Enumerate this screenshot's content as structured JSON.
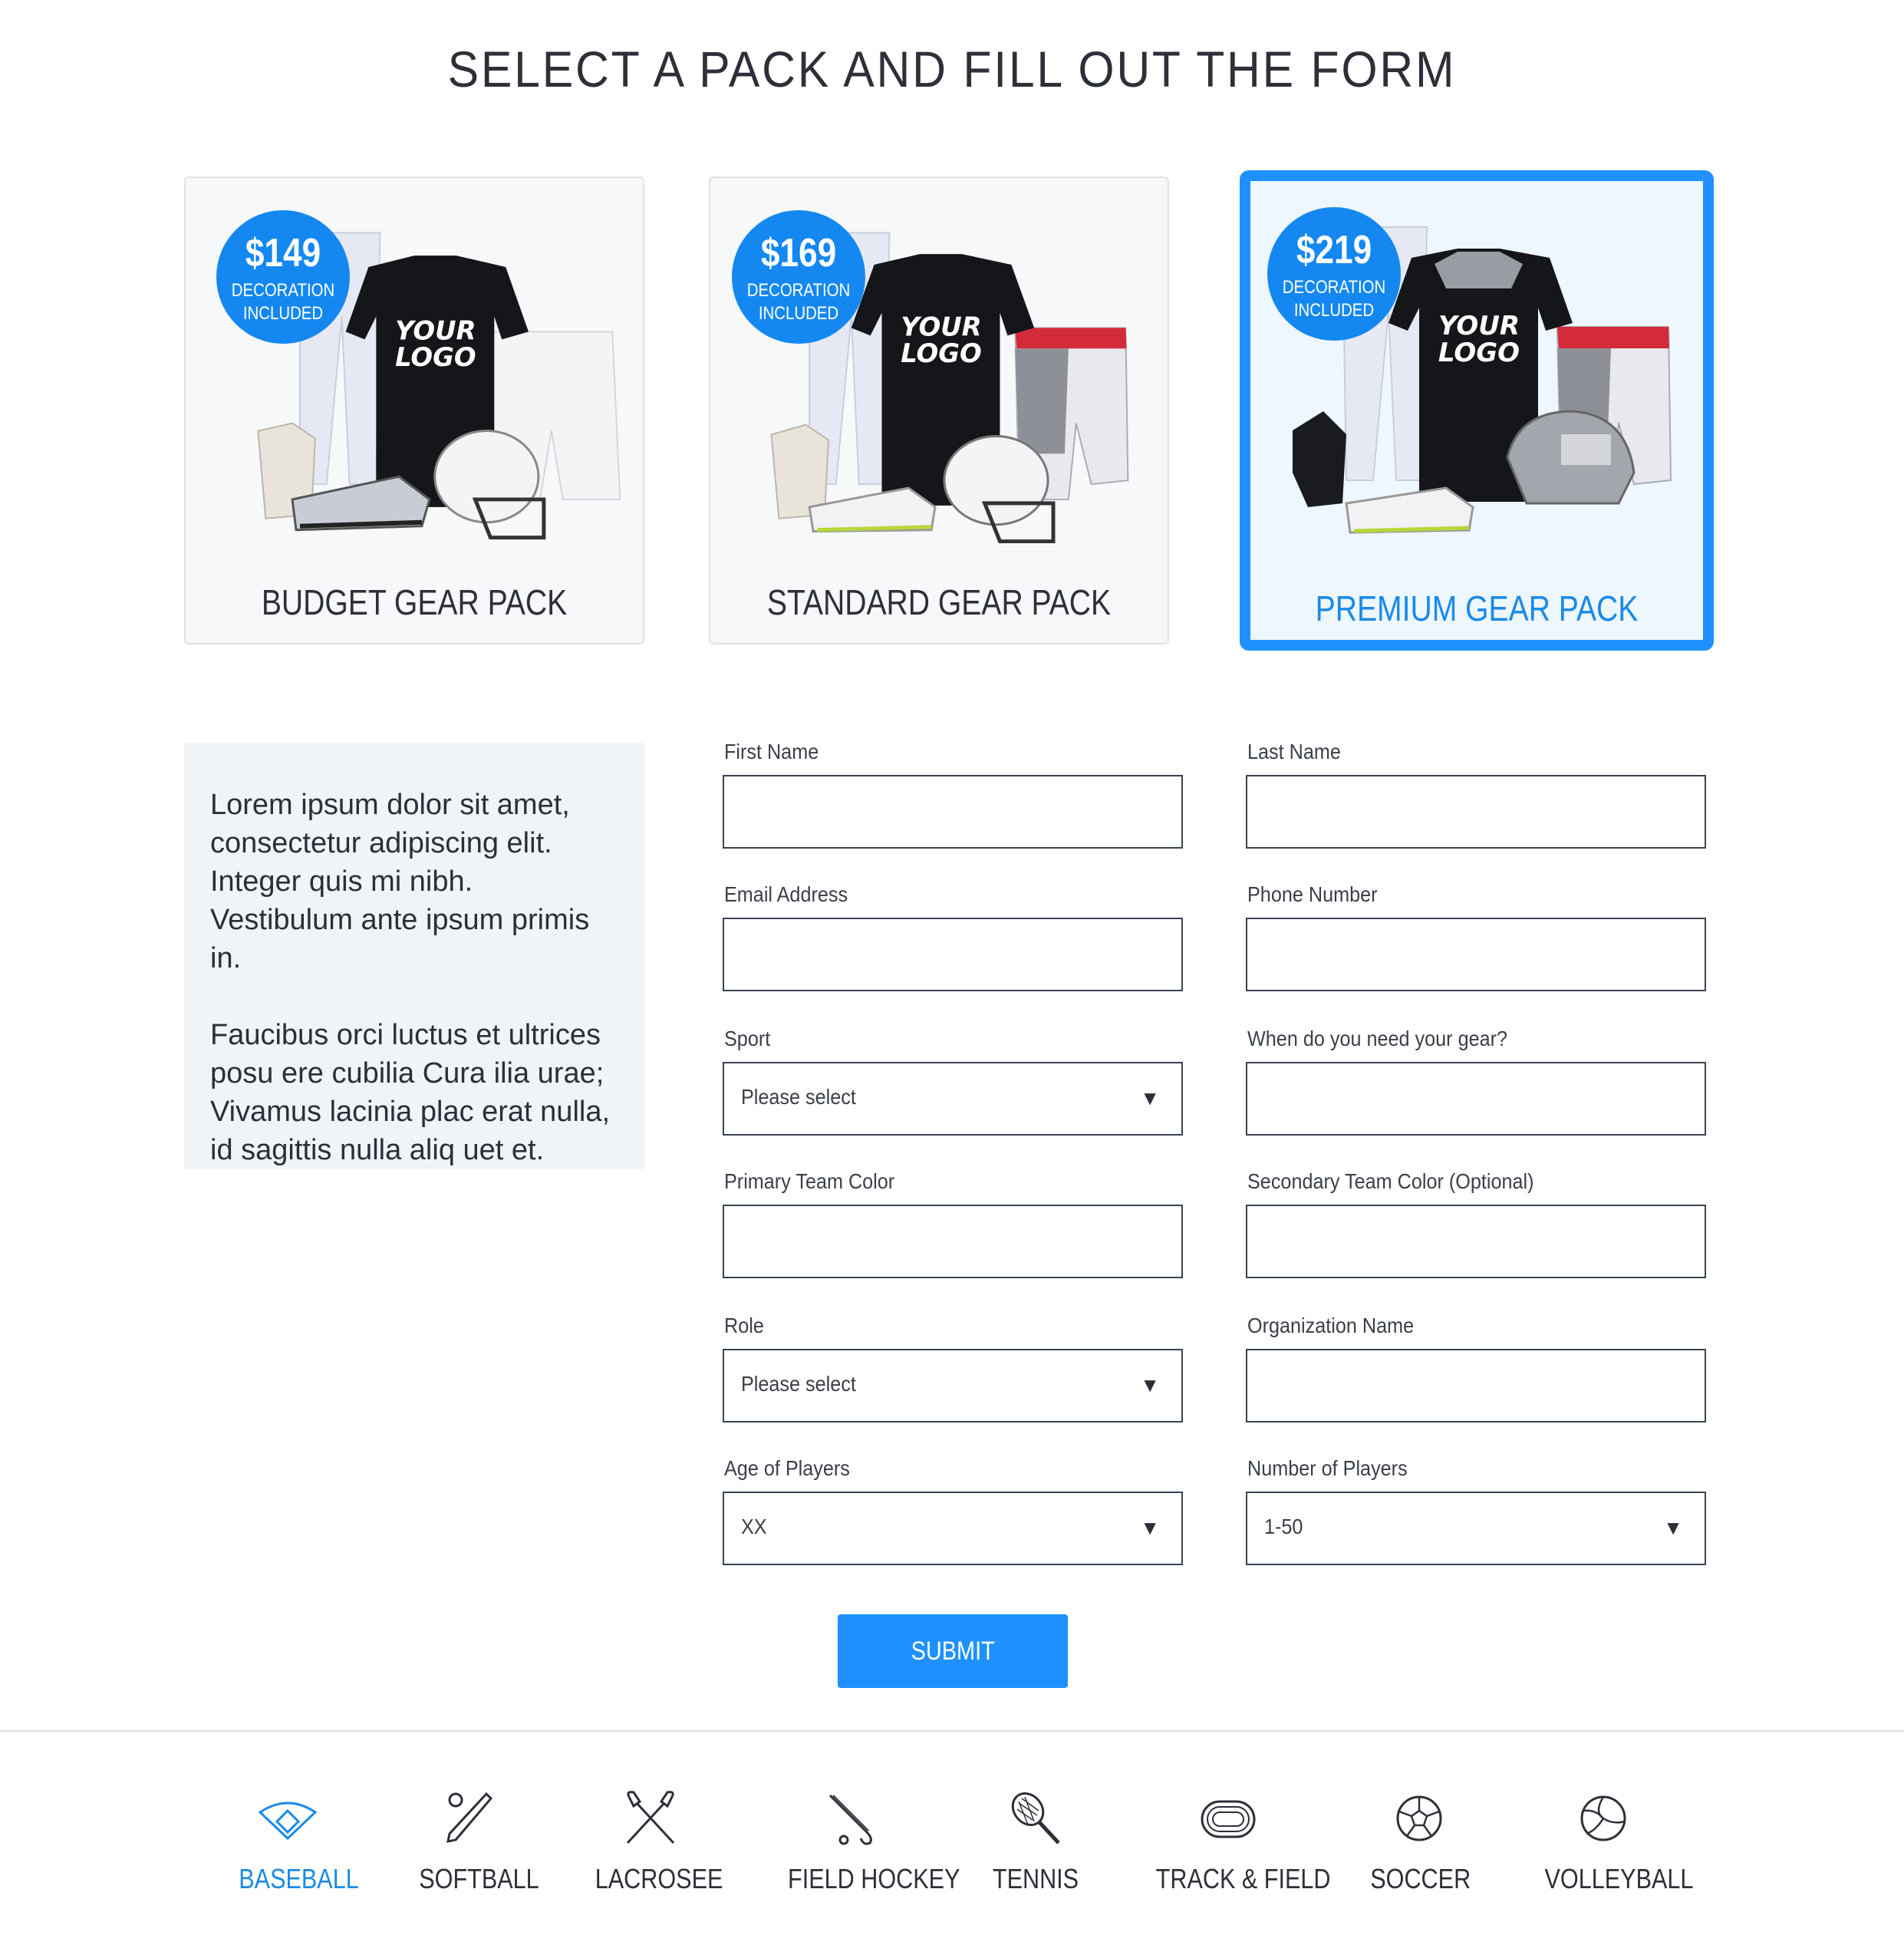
{
  "page": {
    "title": "SELECT A PACK AND FILL OUT THE FORM"
  },
  "packs": [
    {
      "price": "$149",
      "note1": "DECORATION",
      "note2": "INCLUDED",
      "label": "BUDGET GEAR PACK",
      "logo1": "YOUR",
      "logo2": "LOGO"
    },
    {
      "price": "$169",
      "note1": "DECORATION",
      "note2": "INCLUDED",
      "label": "STANDARD GEAR PACK",
      "logo1": "YOUR",
      "logo2": "LOGO"
    },
    {
      "price": "$219",
      "note1": "DECORATION",
      "note2": "INCLUDED",
      "label": "PREMIUM GEAR PACK",
      "logo1": "YOUR",
      "logo2": "LOGO"
    }
  ],
  "selected_pack": "PREMIUM GEAR PACK",
  "info": {
    "paragraph1": "Lorem ipsum dolor sit amet, consectetur adipiscing elit. Integer quis mi nibh. Vestibulum ante ipsum primis in.",
    "paragraph2": "Faucibus orci luctus et ultrices posu ere cubilia Cura ilia urae; Vivamus lacinia plac erat nulla, id sagittis nulla aliq uet et."
  },
  "form": {
    "first_name": {
      "label": "First Name",
      "value": ""
    },
    "last_name": {
      "label": "Last Name",
      "value": ""
    },
    "email": {
      "label": "Email Address",
      "value": ""
    },
    "phone": {
      "label": "Phone Number",
      "value": ""
    },
    "sport": {
      "label": "Sport",
      "value": "Please select"
    },
    "gear_date": {
      "label": "When do you need your gear?",
      "value": ""
    },
    "primary_color": {
      "label": "Primary Team Color",
      "value": ""
    },
    "secondary_color": {
      "label": "Secondary Team Color (Optional)",
      "value": ""
    },
    "role": {
      "label": "Role",
      "value": "Please select"
    },
    "org_name": {
      "label": "Organization Name",
      "value": ""
    },
    "age": {
      "label": "Age of Players",
      "value": "XX"
    },
    "num_players": {
      "label": "Number of Players",
      "value": "1-50"
    },
    "caret": "▼",
    "submit_label": "SUBMIT"
  },
  "sports": [
    {
      "label": "BASEBALL",
      "icon": "baseball-diamond-icon",
      "active": true
    },
    {
      "label": "SOFTBALL",
      "icon": "softball-bat-icon",
      "active": false
    },
    {
      "label": "LACROSEE",
      "icon": "lacrosse-sticks-icon",
      "active": false
    },
    {
      "label": "FIELD HOCKEY",
      "icon": "field-hockey-stick-icon",
      "active": false
    },
    {
      "label": "TENNIS",
      "icon": "tennis-racket-icon",
      "active": false
    },
    {
      "label": "TRACK & FIELD",
      "icon": "running-track-icon",
      "active": false
    },
    {
      "label": "SOCCER",
      "icon": "soccer-ball-icon",
      "active": false
    },
    {
      "label": "VOLLEYBALL",
      "icon": "volleyball-icon",
      "active": false
    }
  ],
  "colors": {
    "accent": "#1e90ff",
    "active_text": "#1a8ae8",
    "badge": "#1488f0"
  }
}
